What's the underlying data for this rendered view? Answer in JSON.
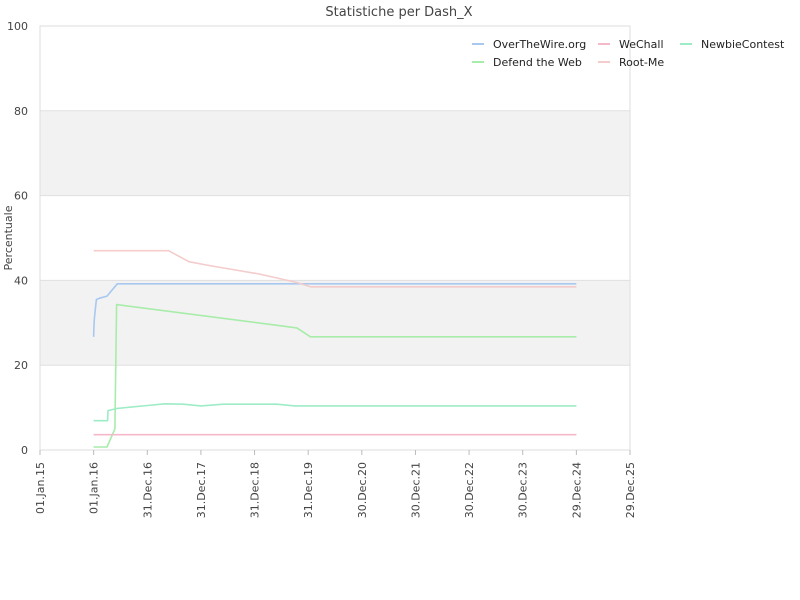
{
  "chart_data": {
    "type": "line",
    "title": "Statistiche per Dash_X",
    "xlabel": "",
    "ylabel": "Percentuale",
    "ylim": [
      0,
      100
    ],
    "xlim": [
      "2015-01-01",
      "2025-12-29"
    ],
    "y_ticks": [
      "0",
      "20",
      "40",
      "60",
      "80",
      "100"
    ],
    "x_ticks": [
      {
        "date": "2015-01-01",
        "label": "01.Jan.15"
      },
      {
        "date": "2016-01-01",
        "label": "01.Jan.16"
      },
      {
        "date": "2016-12-31",
        "label": "31.Dec.16"
      },
      {
        "date": "2017-12-31",
        "label": "31.Dec.17"
      },
      {
        "date": "2018-12-31",
        "label": "31.Dec.18"
      },
      {
        "date": "2019-12-31",
        "label": "31.Dec.19"
      },
      {
        "date": "2020-12-30",
        "label": "30.Dec.20"
      },
      {
        "date": "2021-12-30",
        "label": "30.Dec.21"
      },
      {
        "date": "2022-12-30",
        "label": "30.Dec.22"
      },
      {
        "date": "2023-12-30",
        "label": "30.Dec.23"
      },
      {
        "date": "2024-12-29",
        "label": "29.Dec.24"
      },
      {
        "date": "2025-12-29",
        "label": "29.Dec.25"
      }
    ],
    "grid": true,
    "banded_background": true,
    "band_color": "#f2f2f2",
    "legend_position": "top-right",
    "series": [
      {
        "name": "OverTheWire.org",
        "color": "#a8c8f0",
        "points": [
          [
            "2016-01-01",
            26.7
          ],
          [
            "2016-01-05",
            30.5
          ],
          [
            "2016-01-10",
            32.5
          ],
          [
            "2016-01-20",
            35.5
          ],
          [
            "2016-02-10",
            35.8
          ],
          [
            "2016-04-01",
            36.3
          ],
          [
            "2016-06-10",
            39.2
          ],
          [
            "2019-12-31",
            39.2
          ],
          [
            "2024-12-29",
            39.2
          ]
        ]
      },
      {
        "name": "Defend the Web",
        "color": "#a8ecaa",
        "points": [
          [
            "2016-01-01",
            0.7
          ],
          [
            "2016-04-01",
            0.7
          ],
          [
            "2016-05-25",
            5.0
          ],
          [
            "2016-06-05",
            34.3
          ],
          [
            "2019-10-15",
            28.8
          ],
          [
            "2020-01-15",
            26.7
          ],
          [
            "2024-12-29",
            26.7
          ]
        ]
      },
      {
        "name": "WeChall",
        "color": "#f4b8c8",
        "points": [
          [
            "2016-01-01",
            3.6
          ],
          [
            "2024-12-29",
            3.6
          ]
        ]
      },
      {
        "name": "Root-Me",
        "color": "#f4cccc",
        "points": [
          [
            "2016-01-01",
            47.0
          ],
          [
            "2017-05-25",
            47.0
          ],
          [
            "2017-10-10",
            44.4
          ],
          [
            "2018-03-01",
            43.5
          ],
          [
            "2019-02-01",
            41.5
          ],
          [
            "2019-10-15",
            39.5
          ],
          [
            "2020-01-15",
            38.5
          ],
          [
            "2024-12-29",
            38.5
          ]
        ]
      },
      {
        "name": "NewbieContest",
        "color": "#9eecc6",
        "points": [
          [
            "2016-01-01",
            6.9
          ],
          [
            "2016-04-05",
            6.9
          ],
          [
            "2016-04-08",
            9.3
          ],
          [
            "2016-06-10",
            9.8
          ],
          [
            "2017-01-01",
            10.5
          ],
          [
            "2017-05-01",
            10.9
          ],
          [
            "2017-09-01",
            10.8
          ],
          [
            "2018-01-01",
            10.4
          ],
          [
            "2018-06-01",
            10.8
          ],
          [
            "2019-06-01",
            10.8
          ],
          [
            "2019-10-01",
            10.4
          ],
          [
            "2024-12-29",
            10.4
          ]
        ]
      }
    ]
  }
}
